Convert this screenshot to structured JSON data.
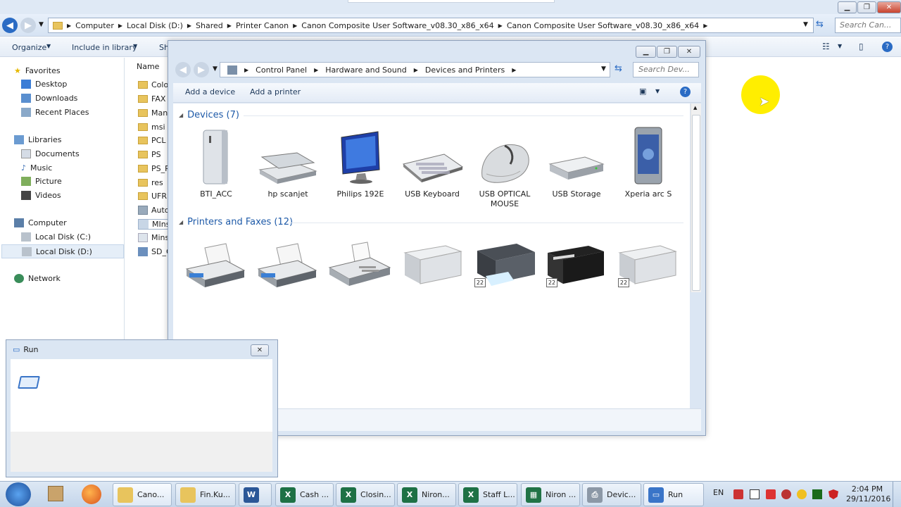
{
  "explorer": {
    "address_crumbs": [
      "Computer",
      "Local Disk (D:)",
      "Shared",
      "Printer Canon",
      "Canon Composite User Software_v08.30_x86_x64",
      "Canon Composite User Software_v08.30_x86_x64"
    ],
    "search_placeholder": "Search Can...",
    "toolbar": {
      "organize": "Organize",
      "include_library": "Include in library",
      "share_partial": "Sh"
    },
    "column_name": "Name",
    "nav": {
      "favorites": "Favorites",
      "desktop": "Desktop",
      "downloads": "Downloads",
      "recent": "Recent Places",
      "libraries": "Libraries",
      "documents": "Documents",
      "music": "Music",
      "picture": "Picture",
      "videos": "Videos",
      "computer": "Computer",
      "disk_c": "Local Disk (C:)",
      "disk_d": "Local Disk (D:)",
      "network": "Network"
    },
    "files": [
      "Colo",
      "FAX",
      "Manu",
      "msi",
      "PCL",
      "PS",
      "PS_P",
      "res",
      "UFRI",
      "Auto",
      "MIns",
      "Mins",
      "SD_C"
    ]
  },
  "devices_window": {
    "crumbs": [
      "Control Panel",
      "Hardware and Sound",
      "Devices and Printers"
    ],
    "search_placeholder": "Search Dev...",
    "toolbar": {
      "add_device": "Add a device",
      "add_printer": "Add a printer"
    },
    "devices_header": "Devices (7)",
    "devices": [
      "BTI_ACC",
      "hp scanjet",
      "Philips 192E",
      "USB Keyboard",
      "USB OPTICAL MOUSE",
      "USB Storage",
      "Xperia arc S"
    ],
    "printers_header": "Printers and Faxes (12)",
    "printer_badge": "22"
  },
  "run": {
    "title": "Run"
  },
  "taskbar": {
    "items": [
      "Cano...",
      "Fin.Ku...",
      "Cash ...",
      "Closin...",
      "Niron...",
      "Staff L...",
      "Niron ...",
      "Devic...",
      "Run"
    ],
    "lang": "EN",
    "time": "2:04 PM",
    "date": "29/11/2016"
  },
  "colors": {
    "accent": "#1e5aa8",
    "taskbar": "#c4d5ea",
    "highlight": "#ffee00"
  }
}
